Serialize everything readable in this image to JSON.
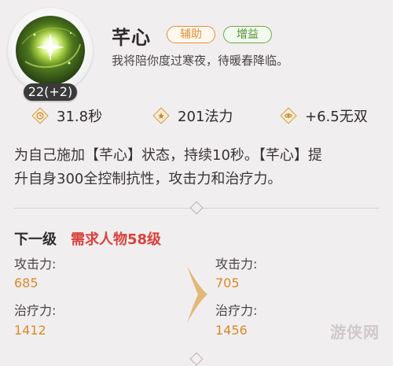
{
  "skill": {
    "name": "芊心",
    "level": "22(+2)",
    "tags": [
      "辅助",
      "增益"
    ],
    "flavor": "我将陪你度过寒夜，待暖春降临。"
  },
  "stats": [
    {
      "icon": "clock-icon",
      "value": "31.8秒"
    },
    {
      "icon": "star-icon",
      "value": "201法力"
    },
    {
      "icon": "eye-icon",
      "value": "+6.5无双"
    }
  ],
  "description": {
    "line1": "为自己施加【芊心】状态，持续10秒。【芊心】提",
    "line2": "升自身300全控制抗性，攻击力和治疗力。"
  },
  "next_level": {
    "title": "下一级",
    "requirement": "需求人物58级",
    "current": {
      "attack_label": "攻击力:",
      "attack_value": "685",
      "heal_label": "治疗力:",
      "heal_value": "1412"
    },
    "next": {
      "attack_label": "攻击力:",
      "attack_value": "705",
      "heal_label": "治疗力:",
      "heal_value": "1456"
    }
  },
  "watermark": "游侠网",
  "colors": {
    "background": "#f1eeef",
    "assist_tag": "#e0903a",
    "buff_tag": "#4f8f32",
    "requirement": "#d9413c",
    "value": "#d88a2a"
  }
}
